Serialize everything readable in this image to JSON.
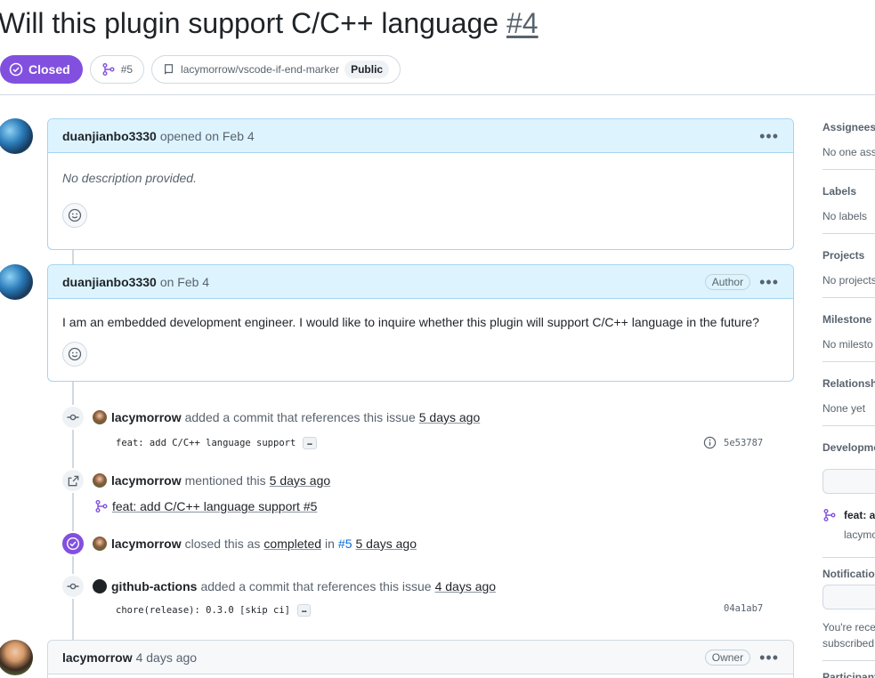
{
  "issue": {
    "title": "Will this plugin support C/C++ language",
    "number": "#4",
    "state_label": "Closed",
    "linked_pr": "#5",
    "repo": "lacymorrow/vscode-if-end-marker",
    "visibility": "Public"
  },
  "comments": [
    {
      "author": "duanjianbo3330",
      "meta": "opened on Feb 4",
      "body": "No description provided."
    },
    {
      "author": "duanjianbo3330",
      "meta": "on Feb 4",
      "badge": "Author",
      "body": "I am an embedded development engineer. I would like to inquire whether this plugin will support C/C++ language in the future?"
    },
    {
      "author": "lacymorrow",
      "meta": "4 days ago",
      "badge": "Owner"
    }
  ],
  "events": [
    {
      "actor": "lacymorrow",
      "text": "added a commit that references this issue",
      "time": "5 days ago",
      "commit_msg": "feat: add C/C++ language support",
      "sha": "5e53787"
    },
    {
      "actor": "lacymorrow",
      "text": "mentioned this",
      "time": "5 days ago",
      "pr_title": "feat: add C/C++ language support #5"
    },
    {
      "actor": "lacymorrow",
      "text": "closed this as",
      "reason": "completed",
      "in_text": "in",
      "pr_ref": "#5",
      "time": "5 days ago"
    },
    {
      "actor": "github-actions",
      "text": "added a commit that references this issue",
      "time": "4 days ago",
      "commit_msg": "chore(release): 0.3.0 [skip ci]",
      "sha": "04a1ab7"
    }
  ],
  "sidebar": {
    "assignees": {
      "title": "Assignees",
      "value": "No one ass"
    },
    "labels": {
      "title": "Labels",
      "value": "No labels"
    },
    "projects": {
      "title": "Projects",
      "value": "No projects"
    },
    "milestone": {
      "title": "Milestone",
      "value": "No milesto"
    },
    "relationships": {
      "title": "Relationshi",
      "value": "None yet"
    },
    "development": {
      "title": "Developme",
      "pr_title": "feat: ac",
      "pr_author": "lacymo"
    },
    "notifications": {
      "title": "Notification",
      "line1": "You're rece",
      "line2": "subscribed"
    },
    "participants": {
      "title": "Participant"
    }
  },
  "colors": {
    "closed_purple": "#8250df",
    "link_blue": "#0969da",
    "comment_border": "#a6d4f2",
    "comment_header": "#ddf4ff"
  }
}
